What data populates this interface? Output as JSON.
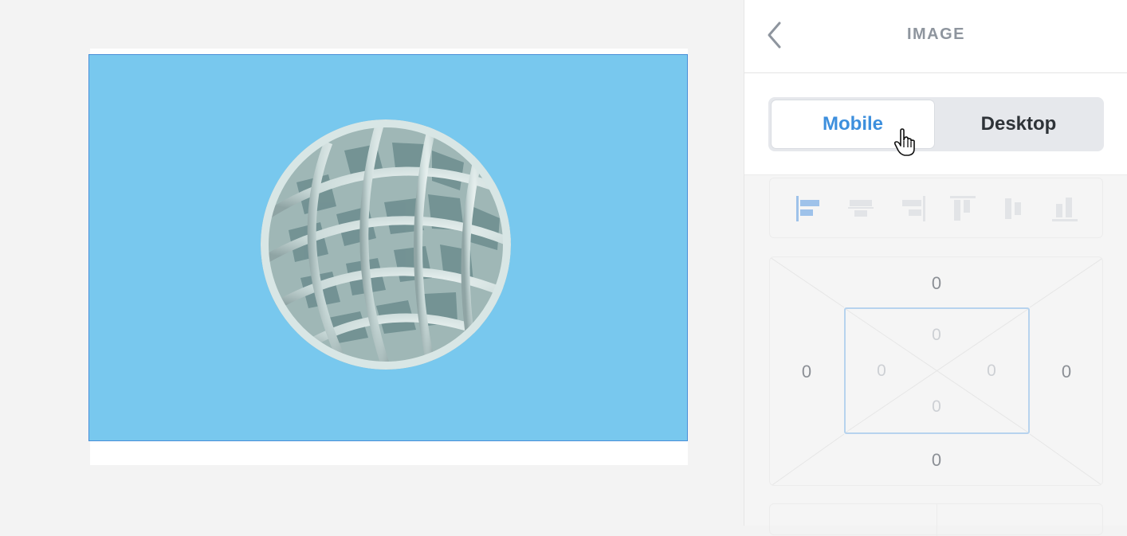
{
  "panel": {
    "title": "IMAGE",
    "device_toggle": {
      "mobile_label": "Mobile",
      "desktop_label": "Desktop",
      "selected": "Mobile"
    },
    "spacing": {
      "margin_top": "0",
      "margin_right": "0",
      "margin_bottom": "0",
      "margin_left": "0",
      "padding_top": "0",
      "padding_right": "0",
      "padding_bottom": "0",
      "padding_left": "0"
    }
  },
  "colors": {
    "image_background": "#78c8ee",
    "selection_border": "#4a8fd8",
    "accent": "#3d8fdd"
  },
  "icons": [
    "chevron-left-icon",
    "align-left-icon",
    "align-center-h-icon",
    "align-right-icon",
    "align-top-icon",
    "align-middle-v-icon",
    "align-bottom-icon",
    "hand-pointer-cursor-icon"
  ]
}
